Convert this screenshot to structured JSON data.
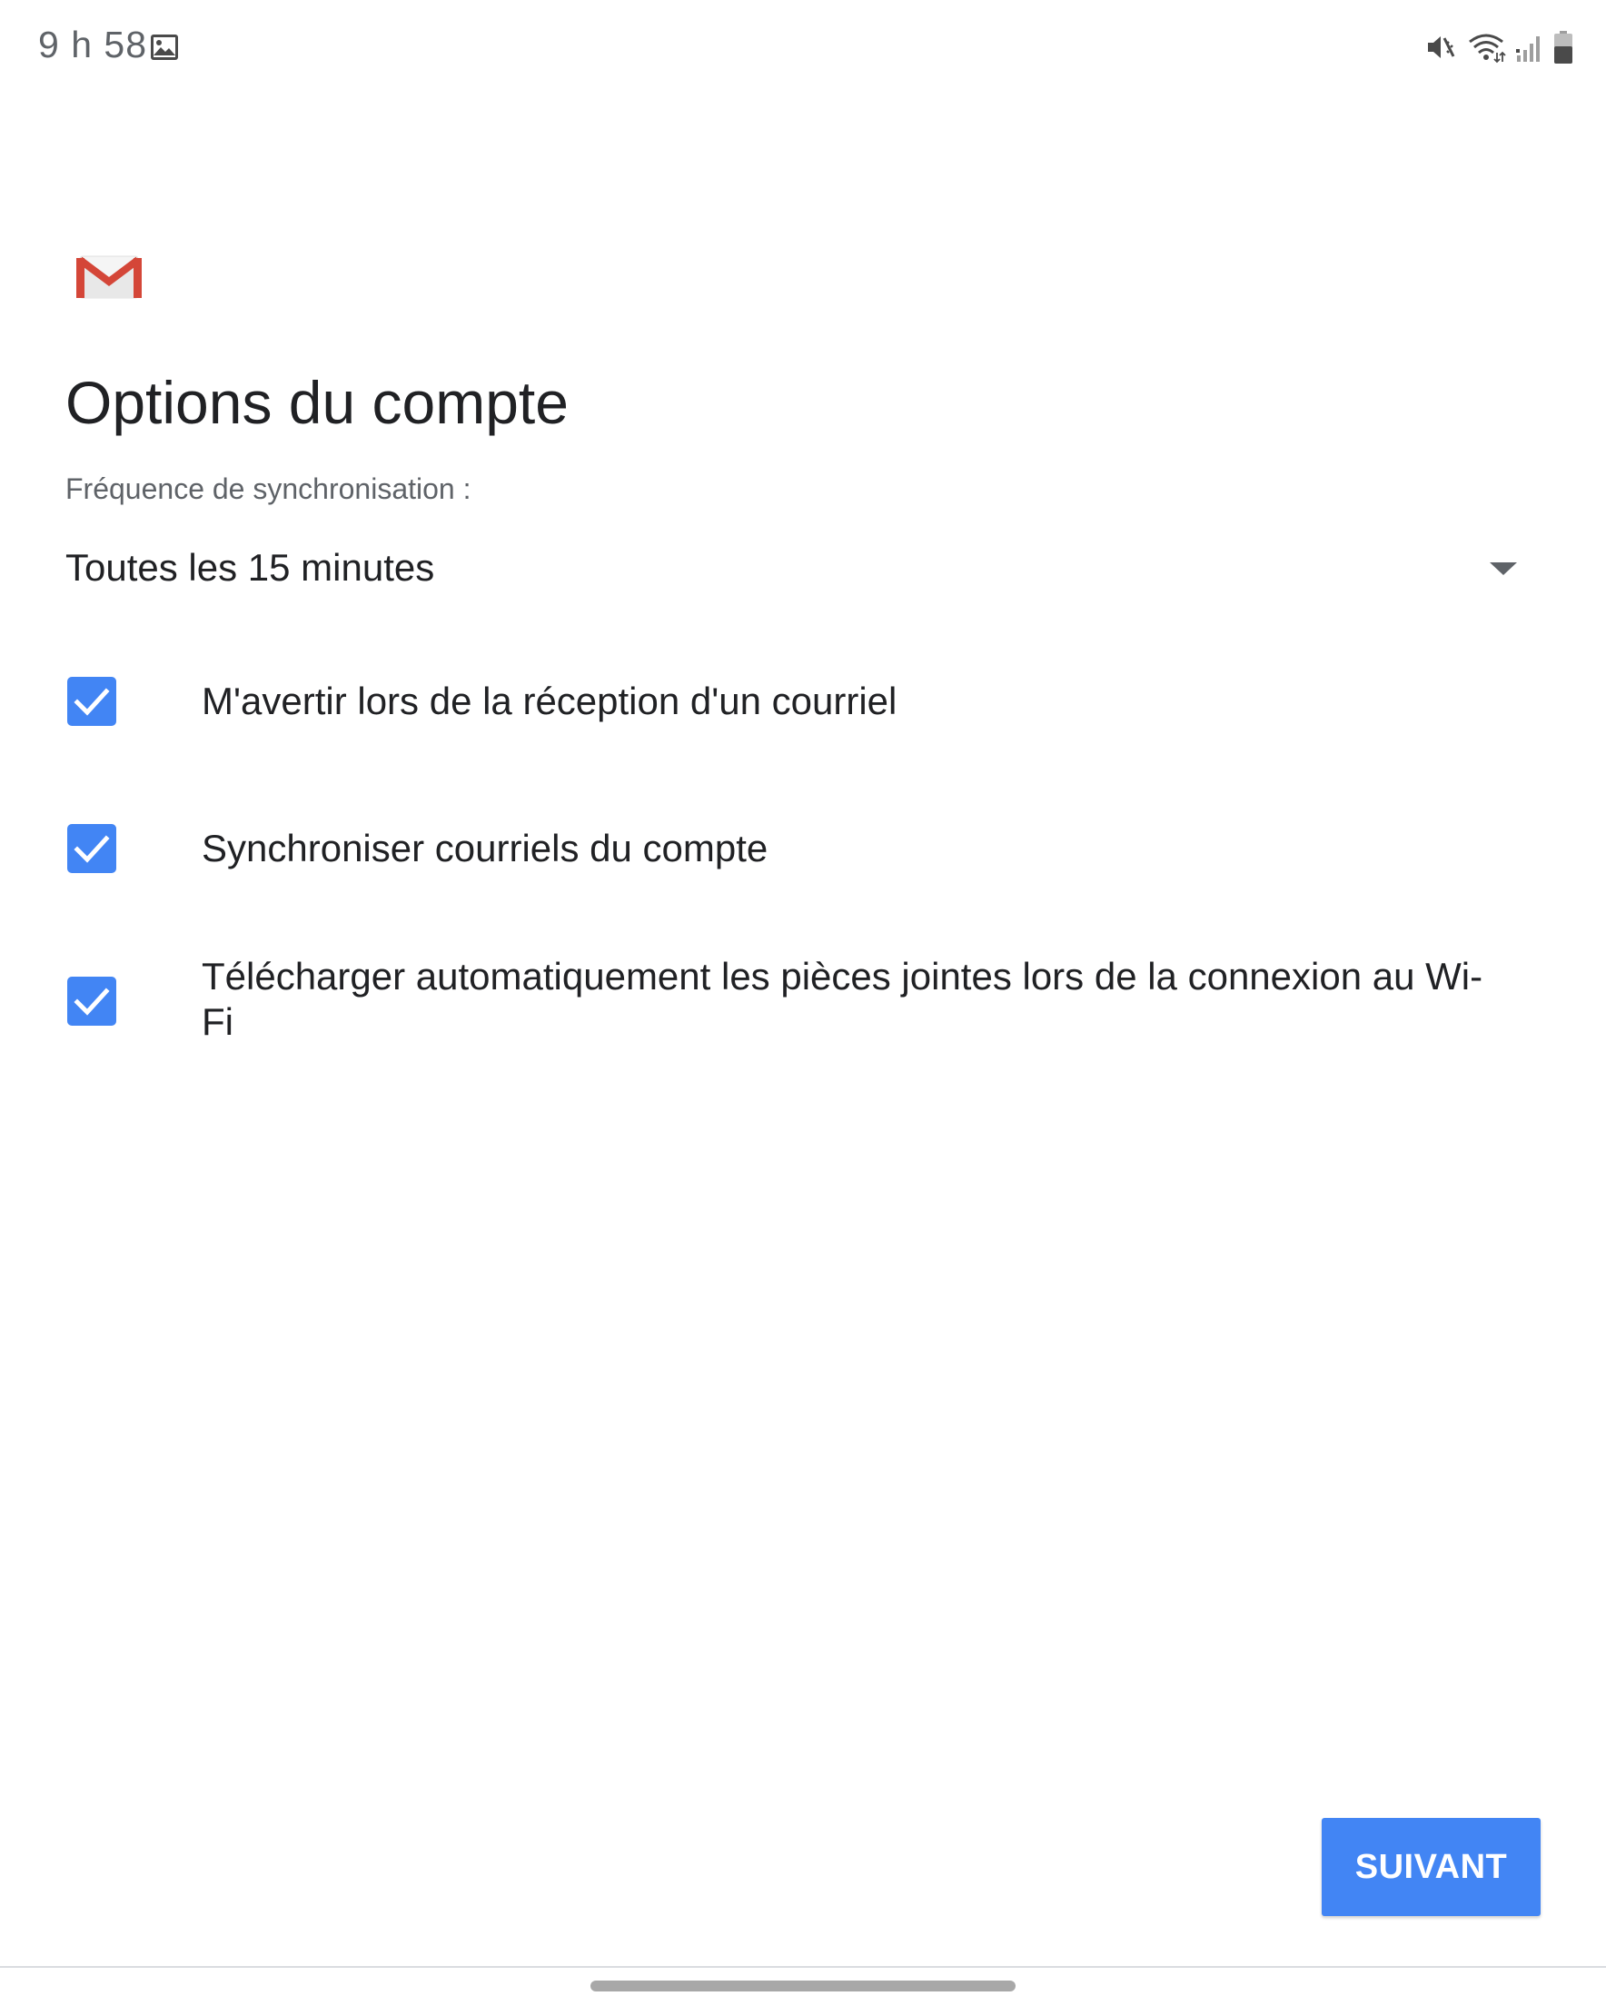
{
  "status_bar": {
    "time": "9 h 58",
    "icons": [
      "gallery-icon",
      "vibrate-mute-icon",
      "wifi-icon",
      "signal-icon",
      "battery-icon"
    ]
  },
  "app": {
    "logo": "gmail-logo",
    "brand_colors": {
      "red": "#d44638",
      "accent": "#4285f4"
    }
  },
  "page": {
    "title": "Options du compte",
    "sync_frequency": {
      "label": "Fréquence de synchronisation :",
      "selected": "Toutes les 15 minutes"
    },
    "options": [
      {
        "label": "M'avertir lors de la réception d'un courriel",
        "checked": true
      },
      {
        "label": "Synchroniser courriels du compte",
        "checked": true
      },
      {
        "label": "Télécharger automatiquement les pièces jointes lors de la connexion au Wi-Fi",
        "checked": true
      }
    ],
    "next_button": "SUIVANT"
  }
}
